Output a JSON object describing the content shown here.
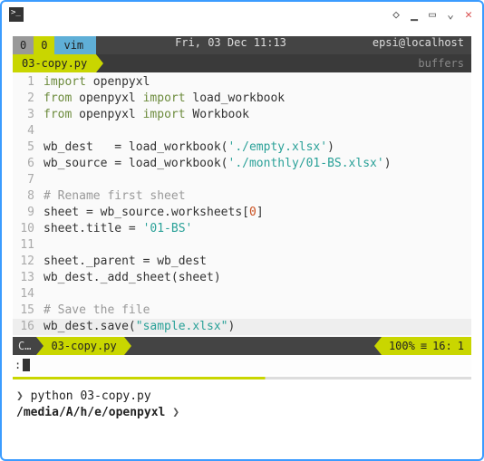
{
  "vim_top": {
    "seg0": "0",
    "seg1": "0",
    "mode": "vim",
    "datetime": "Fri, 03 Dec 11:13",
    "userhost": "epsi@localhost"
  },
  "tab": {
    "filename": "03-copy.py",
    "right": "buffers"
  },
  "lines": [
    {
      "n": "1",
      "tokens": [
        [
          "kw",
          "import"
        ],
        [
          "",
          " openpyxl"
        ]
      ]
    },
    {
      "n": "2",
      "tokens": [
        [
          "kw",
          "from"
        ],
        [
          "",
          " openpyxl "
        ],
        [
          "kw",
          "import"
        ],
        [
          "",
          " load_workbook"
        ]
      ]
    },
    {
      "n": "3",
      "tokens": [
        [
          "kw",
          "from"
        ],
        [
          "",
          " openpyxl "
        ],
        [
          "kw",
          "import"
        ],
        [
          "",
          " Workbook"
        ]
      ]
    },
    {
      "n": "4",
      "tokens": []
    },
    {
      "n": "5",
      "tokens": [
        [
          "",
          "wb_dest   = load_workbook("
        ],
        [
          "str",
          "'./empty.xlsx'"
        ],
        [
          "",
          ")"
        ]
      ]
    },
    {
      "n": "6",
      "tokens": [
        [
          "",
          "wb_source = load_workbook("
        ],
        [
          "str",
          "'./monthly/01-BS.xlsx'"
        ],
        [
          "",
          ")"
        ]
      ]
    },
    {
      "n": "7",
      "tokens": []
    },
    {
      "n": "8",
      "tokens": [
        [
          "cmt",
          "# Rename first sheet"
        ]
      ]
    },
    {
      "n": "9",
      "tokens": [
        [
          "",
          "sheet = wb_source.worksheets["
        ],
        [
          "num",
          "0"
        ],
        [
          "",
          "]"
        ]
      ]
    },
    {
      "n": "10",
      "tokens": [
        [
          "",
          "sheet.title = "
        ],
        [
          "str",
          "'01-BS'"
        ]
      ]
    },
    {
      "n": "11",
      "tokens": []
    },
    {
      "n": "12",
      "tokens": [
        [
          "",
          "sheet._parent = wb_dest"
        ]
      ]
    },
    {
      "n": "13",
      "tokens": [
        [
          "",
          "wb_dest._add_sheet(sheet)"
        ]
      ]
    },
    {
      "n": "14",
      "tokens": []
    },
    {
      "n": "15",
      "tokens": [
        [
          "cmt",
          "# Save the file"
        ]
      ]
    },
    {
      "n": "16",
      "tokens": [
        [
          "",
          "wb_dest.save("
        ],
        [
          "str",
          "\"sample.xlsx\""
        ],
        [
          "",
          ")"
        ]
      ],
      "cursor": true
    }
  ],
  "status": {
    "mode": "C…",
    "file": "03-copy.py",
    "percent": "100%",
    "eq": "≡",
    "line": "16:",
    "col": "1"
  },
  "cmdline": ":",
  "terminal": {
    "line1_prompt": "❯",
    "line1_cmd": "python 03-copy.py",
    "line2_path": "/media/A/h/e/",
    "line2_dir": "openpyxl",
    "line2_prompt": "❯"
  }
}
